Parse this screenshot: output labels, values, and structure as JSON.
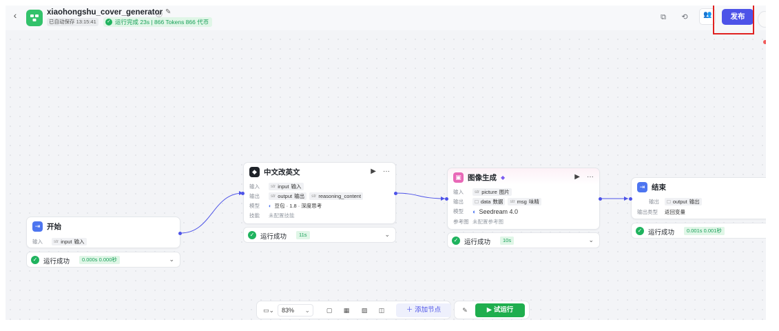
{
  "header": {
    "title": "xiaohongshu_cover_generator",
    "autosave": "已自动保存 13:15:41",
    "run_status": "运行完成 23s | 866 Tokens  866 代币",
    "publish_label": "发布"
  },
  "nodes": {
    "start": {
      "title": "开始",
      "input_label": "输入",
      "input_type": "str",
      "input_name": "input",
      "input_desc": "输入",
      "status": "运行成功",
      "time": "0.000s 0.000秒"
    },
    "translate": {
      "title": "中文改英文",
      "input_label": "输入",
      "input_type": "str",
      "input_name": "input",
      "input_desc": "输入",
      "output_label": "输出",
      "out1_type": "str",
      "out1_name": "output",
      "out1_desc": "输出",
      "out2_type": "str",
      "out2_name": "reasoning_content",
      "model_label": "模型",
      "model_value": "豆包 · 1.8 · 深度思考",
      "skill_label": "技能",
      "skill_value": "未配置技能",
      "status": "运行成功",
      "time": "11s"
    },
    "image": {
      "title": "图像生成",
      "input_label": "输入",
      "input_type": "str",
      "input_name": "picture",
      "input_desc": "图片",
      "output_label": "输出",
      "out1_type": "☐",
      "out1_name": "data",
      "out1_desc": "数据",
      "out2_type": "str",
      "out2_name": "msg",
      "out2_desc": "味精",
      "model_label": "模型",
      "model_value": "Seedream 4.0",
      "ref_label": "参考图",
      "ref_value": "未配置参考图",
      "status": "运行成功",
      "time": "10s"
    },
    "end": {
      "title": "结束",
      "output_label": "输出",
      "out_type": "☐",
      "out_name": "output",
      "out_desc": "输出",
      "out_kind_label": "输出类型",
      "out_kind_value": "返回变量",
      "status": "运行成功",
      "time": "0.001s 0.001秒"
    }
  },
  "toolbar": {
    "zoom": "83%",
    "add_node": "添加节点",
    "trial_run": "试运行"
  },
  "colors": {
    "accent": "#4d53e8",
    "success": "#1fb35e",
    "run_button": "#1fae4e",
    "highlight": "#e02020"
  }
}
